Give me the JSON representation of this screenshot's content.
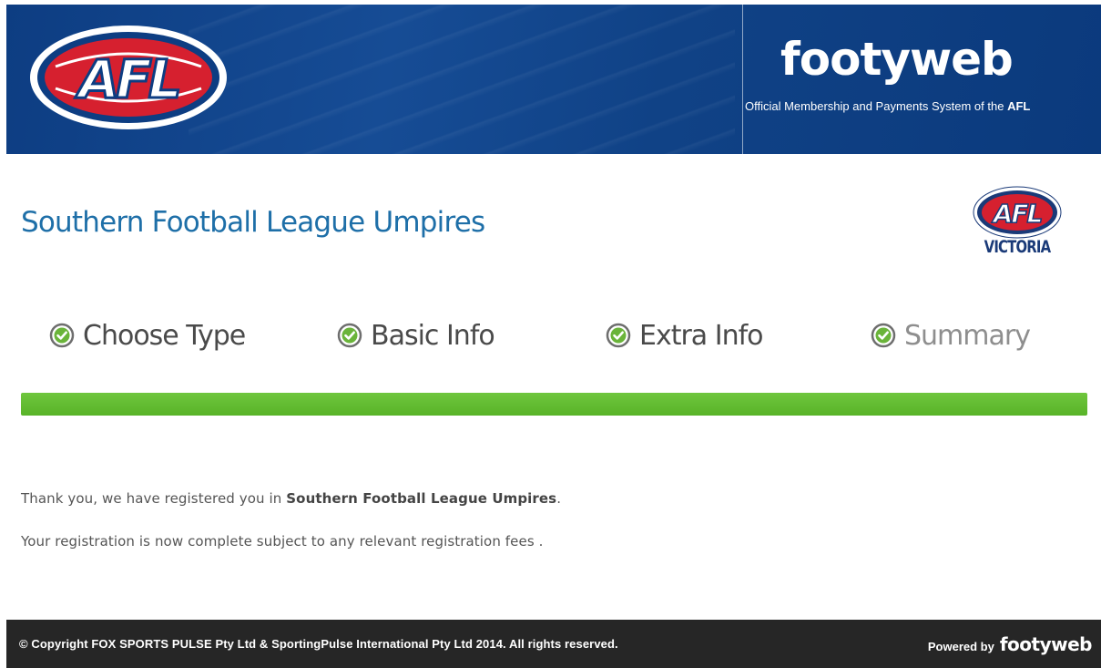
{
  "header": {
    "logo_text": "AFL",
    "brand": "footyweb",
    "tagline_prefix": "Official Membership and Payments System of the ",
    "tagline_emphasis": "AFL"
  },
  "league": {
    "title": "Southern Football League Umpires",
    "badge_logo_text": "AFL",
    "badge_label": "VICTORIA"
  },
  "steps": [
    {
      "label": "Choose Type",
      "icon": "check-circle-icon",
      "state": "complete"
    },
    {
      "label": "Basic Info",
      "icon": "check-circle-icon",
      "state": "complete"
    },
    {
      "label": "Extra Info",
      "icon": "check-circle-icon",
      "state": "complete"
    },
    {
      "label": "Summary",
      "icon": "check-circle-icon",
      "state": "current"
    }
  ],
  "progress": {
    "percent": 100,
    "color": "#5fba30"
  },
  "messages": {
    "line1_prefix": "Thank you, we have registered you in ",
    "line1_org": "Southern Football League Umpires",
    "line1_suffix": ".",
    "line2": "Your registration is now complete subject to any relevant registration fees ."
  },
  "footer": {
    "copyright": "©  Copyright FOX SPORTS PULSE Pty Ltd & SportingPulse International Pty Ltd  2014.  All rights reserved.",
    "powered_label": "Powered by",
    "powered_brand": "footyweb"
  },
  "colors": {
    "banner": "#104286",
    "title": "#1e6fa8",
    "check": "#6ab43a",
    "footer": "#262626"
  }
}
